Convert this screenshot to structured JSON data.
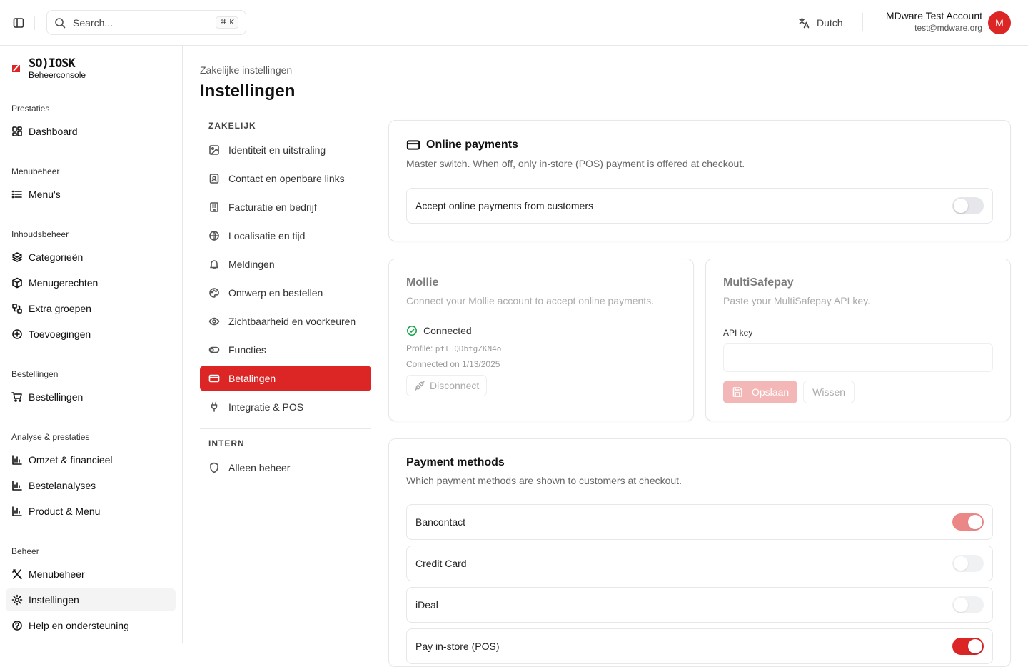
{
  "topbar": {
    "search_placeholder": "Search...",
    "shortcut": "⌘ K",
    "language": "Dutch",
    "user_name": "MDware Test Account",
    "user_email": "test@mdware.org",
    "avatar_letter": "M"
  },
  "brand": {
    "logo": "SO)IOSK",
    "subtitle": "Beheerconsole",
    "accent": "#dc2626"
  },
  "sidebar": {
    "sections": {
      "prestaties": "Prestaties",
      "menubeheer": "Menubeheer",
      "inhoudsbeheer": "Inhoudsbeheer",
      "bestellingen": "Bestellingen",
      "analyse": "Analyse & prestaties",
      "beheer": "Beheer"
    },
    "items": {
      "dashboard": "Dashboard",
      "menus": "Menu's",
      "categorieen": "Categorieën",
      "menugerechten": "Menugerechten",
      "extra_groepen": "Extra groepen",
      "toevoegingen": "Toevoegingen",
      "bestellingen": "Bestellingen",
      "omzet": "Omzet & financieel",
      "bestelanalyses": "Bestelanalyses",
      "product_menu": "Product & Menu",
      "menubeheer": "Menubeheer",
      "instellingen": "Instellingen",
      "help": "Help en ondersteuning"
    }
  },
  "page": {
    "breadcrumb": "Zakelijke instellingen",
    "title": "Instellingen"
  },
  "settings_nav": {
    "heading_business": "ZAKELIJK",
    "heading_internal": "INTERN",
    "items": [
      "Identiteit en uitstraling",
      "Contact en openbare links",
      "Facturatie en bedrijf",
      "Localisatie en tijd",
      "Meldingen",
      "Ontwerp en bestellen",
      "Zichtbaarheid en voorkeuren",
      "Functies",
      "Betalingen",
      "Integratie & POS"
    ],
    "internal_item": "Alleen beheer",
    "active": "Betalingen"
  },
  "online_payments": {
    "title": "Online payments",
    "description": "Master switch. When off, only in-store (POS) payment is offered at checkout.",
    "toggle_label": "Accept online payments from customers",
    "enabled": false
  },
  "mollie": {
    "title": "Mollie",
    "description": "Connect your Mollie account to accept online payments.",
    "status": "Connected",
    "profile_label": "Profile:",
    "profile_id": "pfl_QDbtgZKN4o",
    "connected_on": "Connected on 1/13/2025",
    "disconnect": "Disconnect"
  },
  "multisafepay": {
    "title": "MultiSafepay",
    "description": "Paste your MultiSafepay API key.",
    "api_key_label": "API key",
    "api_key_value": "",
    "save": "Opslaan",
    "clear": "Wissen"
  },
  "payment_methods": {
    "title": "Payment methods",
    "description": "Which payment methods are shown to customers at checkout.",
    "methods": [
      {
        "label": "Bancontact",
        "enabled": true
      },
      {
        "label": "Credit Card",
        "enabled": false
      },
      {
        "label": "iDeal",
        "enabled": false
      },
      {
        "label": "Pay in-store (POS)",
        "enabled": true
      }
    ]
  }
}
